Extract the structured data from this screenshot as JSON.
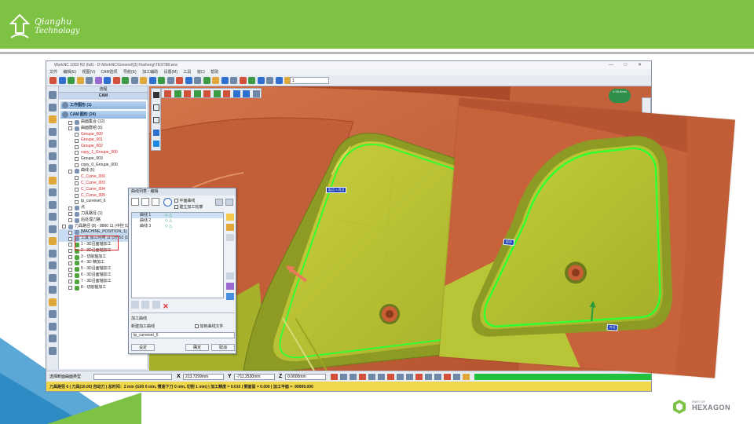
{
  "brand": {
    "line1": "Qianghu",
    "line2": "Technology"
  },
  "footer": {
    "part_of": "PART OF",
    "name": "HEXAGON"
  },
  "app": {
    "title": "WorkNC 1003 R2 (full) - D:\\WorkNC\\Gonerel\\[3] Hosheng\\TEST88.wnc",
    "menu": [
      "文件",
      "编辑(E)",
      "视图(V)",
      "CAM选项",
      "导航(E)",
      "加工辅助",
      "设置(M)",
      "工具",
      "窗口",
      "帮助"
    ],
    "toolbar_select": "1",
    "tree": {
      "head": "流程",
      "head2": "CAM",
      "section1": "工作图形 (1)",
      "section2": "CAM 图形 (24)",
      "items": [
        {
          "label": "曲面集合 (12)",
          "indent": 1,
          "red": false
        },
        {
          "label": "曲面群组 (6)",
          "indent": 1,
          "red": false
        },
        {
          "label": "Groupe_000",
          "indent": 2,
          "red": true
        },
        {
          "label": "Groupe_001",
          "indent": 2,
          "red": true
        },
        {
          "label": "Groupe_002",
          "indent": 2,
          "red": true
        },
        {
          "label": "copy_1_Groupe_000",
          "indent": 2,
          "red": true
        },
        {
          "label": "Groupe_003",
          "indent": 2,
          "red": false
        },
        {
          "label": "copy_0_Groupe_000",
          "indent": 2,
          "red": false
        },
        {
          "label": "曲线 (5)",
          "indent": 1,
          "red": false
        },
        {
          "label": "C_Curve_000",
          "indent": 2,
          "red": true
        },
        {
          "label": "C_Curve_003",
          "indent": 2,
          "red": true
        },
        {
          "label": "C_Curve_004",
          "indent": 2,
          "red": true
        },
        {
          "label": "C_Curve_005",
          "indent": 2,
          "red": true
        },
        {
          "label": "tp_curveset_6",
          "indent": 2,
          "red": false
        },
        {
          "label": "点",
          "indent": 1,
          "red": false
        },
        {
          "label": "刀具路径 (1)",
          "indent": 1,
          "red": false
        },
        {
          "label": "后处理刀路",
          "indent": 1,
          "red": false
        },
        {
          "label": "刀具路径 (8) - 8860 11 (中控 52 /",
          "indent": 0,
          "red": false
        },
        {
          "label": "[MACHINE_POSITION_1]",
          "indent": 1,
          "red": false,
          "hl": true
        },
        {
          "label": "工具 加工时间 11 (3分52 (1)",
          "indent": 1,
          "red": false,
          "hl": true
        },
        {
          "label": "1 - 3D沿面轴加工",
          "indent": 1,
          "red": false,
          "green": true
        },
        {
          "label": "2 - 3D沿面轴加工",
          "indent": 1,
          "red": false,
          "green": true
        },
        {
          "label": "3 - 切削轴加工",
          "indent": 1,
          "red": false,
          "green": true
        },
        {
          "label": "4 - 3D 精加工",
          "indent": 1,
          "red": false,
          "green": true
        },
        {
          "label": "5 - 3D沿面轴加工",
          "indent": 1,
          "red": false,
          "green": true
        },
        {
          "label": "6 - 3D沿面轴加工",
          "indent": 1,
          "red": false,
          "green": true
        },
        {
          "label": "7 - 3D沿面轴加工",
          "indent": 1,
          "red": false,
          "green": true
        },
        {
          "label": "8 - 切削轴加工",
          "indent": 1,
          "red": false,
          "green": true
        }
      ]
    },
    "dialog": {
      "title": "曲线列表 - 编辑",
      "checkbox1": "平面曲线",
      "checkbox2": "建立加工轮廓",
      "rows": [
        "曲线 1",
        "曲线 2",
        "曲线 3"
      ],
      "section": "加工曲线",
      "new_label": "新建加工曲线",
      "save_label": "加到曲线文件",
      "name_value": "tp_curveset_6",
      "btn_settings": "设定",
      "btn_ok": "确定",
      "btn_cancel": "取消"
    },
    "viewport": {
      "nav_label": "≥ 25.0mm",
      "tag_start": "起点:1 终点",
      "tag_small": "起点",
      "tag_end": "终点"
    },
    "status": {
      "hint": "选择断面曲面类型",
      "x": "213.7299mm",
      "y": "-711.2530mm",
      "z": "0.0000mm",
      "bottom": "刀具路径 6 | 刀具(10.00) 自动刀 | 总时间：2 min (G00 0 min, 慢速下刀 0 min, 切削 1 min) | 加工精度 = 0.010 | 侧面留 = 0.000 | 加工平面 = -99999.000"
    },
    "colors": {
      "part": "#c9643e",
      "floor": "#b8c536",
      "curve": "#33ff33",
      "accent": "#7dc242"
    }
  }
}
